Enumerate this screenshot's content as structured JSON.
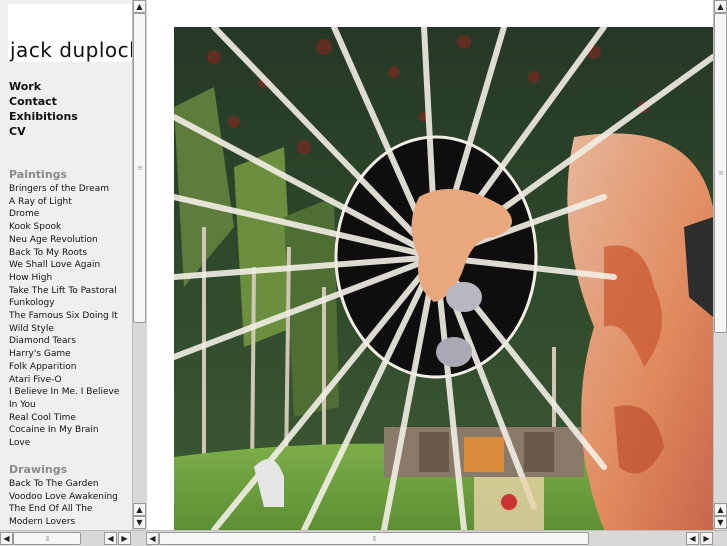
{
  "logo": {
    "text": "jack duplock"
  },
  "nav": [
    {
      "label": "Work"
    },
    {
      "label": "Contact"
    },
    {
      "label": "Exhibitions"
    },
    {
      "label": "CV"
    }
  ],
  "sections": [
    {
      "title": "Paintings",
      "items": [
        "Bringers of the Dream",
        "A Ray of Light",
        "Drome",
        "Kook Spook",
        "Neu Age Revolution",
        "Back To My Roots",
        "We Shall Love Again",
        "How High",
        "Take The Lift To Pastoral",
        "Funkology",
        "The Famous Six Doing It",
        "Wild Style",
        "Diamond Tears",
        "Harry's Game",
        "Folk Apparition",
        "Atari Five-O",
        "I Believe In Me. I Believe",
        "In You",
        "Real Cool Time",
        "Cocaine In My Brain",
        "Love"
      ]
    },
    {
      "title": "Drawings",
      "items": [
        "Back To The Garden",
        "Voodoo Love Awakening",
        "The End Of All The",
        "Modern Lovers"
      ]
    }
  ],
  "scroll_arrows": {
    "up": "▲",
    "down": "▼",
    "left": "◀",
    "right": "▶"
  },
  "colors": {
    "frame_bg": "#efefef",
    "section_heading": "#8a8a8a",
    "scrollbar_track": "#d8d8d8"
  }
}
